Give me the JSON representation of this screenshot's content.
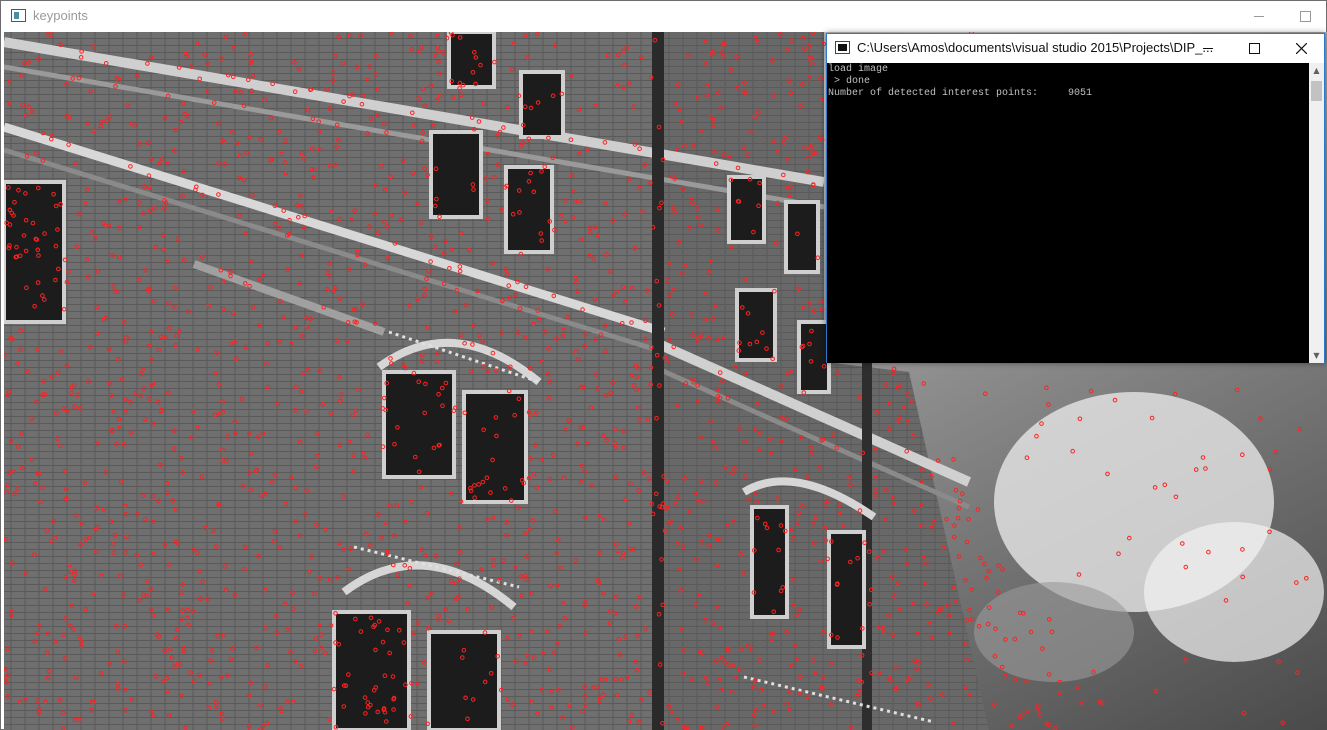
{
  "main_window": {
    "title": "keypoints"
  },
  "image": {
    "description_tag": "grayscale building facade with detected keypoints",
    "keypoint_color": "#ff2222"
  },
  "console": {
    "title": "C:\\Users\\Amos\\documents\\visual studio 2015\\Projects\\DIP_...",
    "lines": [
      "load image",
      " > done",
      "Number of detected interest points:     9051"
    ]
  }
}
